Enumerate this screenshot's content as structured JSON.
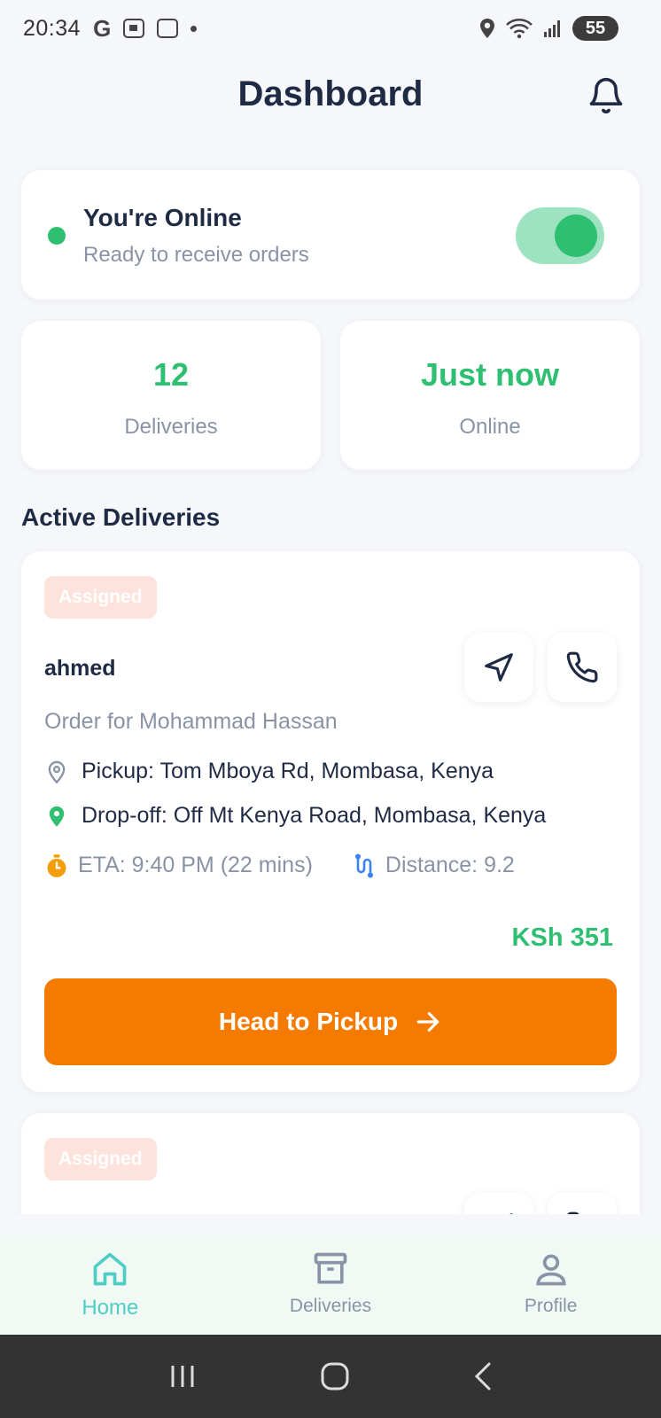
{
  "status_bar": {
    "time": "20:34",
    "battery": "55"
  },
  "header": {
    "title": "Dashboard"
  },
  "online_card": {
    "title": "You're Online",
    "subtitle": "Ready to receive orders",
    "toggle_on": true
  },
  "stats": [
    {
      "value": "12",
      "label": "Deliveries"
    },
    {
      "value": "Just now",
      "label": "Online"
    }
  ],
  "section_title": "Active Deliveries",
  "deliveries": [
    {
      "status": "Assigned",
      "customer": "ahmed",
      "order_for": "Order for Mohammad Hassan",
      "pickup": "Pickup: Tom Mboya Rd, Mombasa, Kenya",
      "dropoff": "Drop-off: Off Mt Kenya Road, Mombasa, Kenya",
      "eta": "ETA: 9:40 PM (22 mins)",
      "distance": "Distance: 9.2",
      "price": "KSh 351",
      "action": "Head to Pickup"
    },
    {
      "status": "Assigned"
    }
  ],
  "bottom_nav": [
    {
      "label": "Home",
      "icon": "home-icon",
      "active": true
    },
    {
      "label": "Deliveries",
      "icon": "archive-icon",
      "active": false
    },
    {
      "label": "Profile",
      "icon": "user-icon",
      "active": false
    }
  ],
  "colors": {
    "accent_green": "#2fbf71",
    "primary_orange": "#f47b00",
    "nav_active": "#4ecdc4",
    "text_dark": "#1f2a44",
    "text_muted": "#8a93a6"
  }
}
